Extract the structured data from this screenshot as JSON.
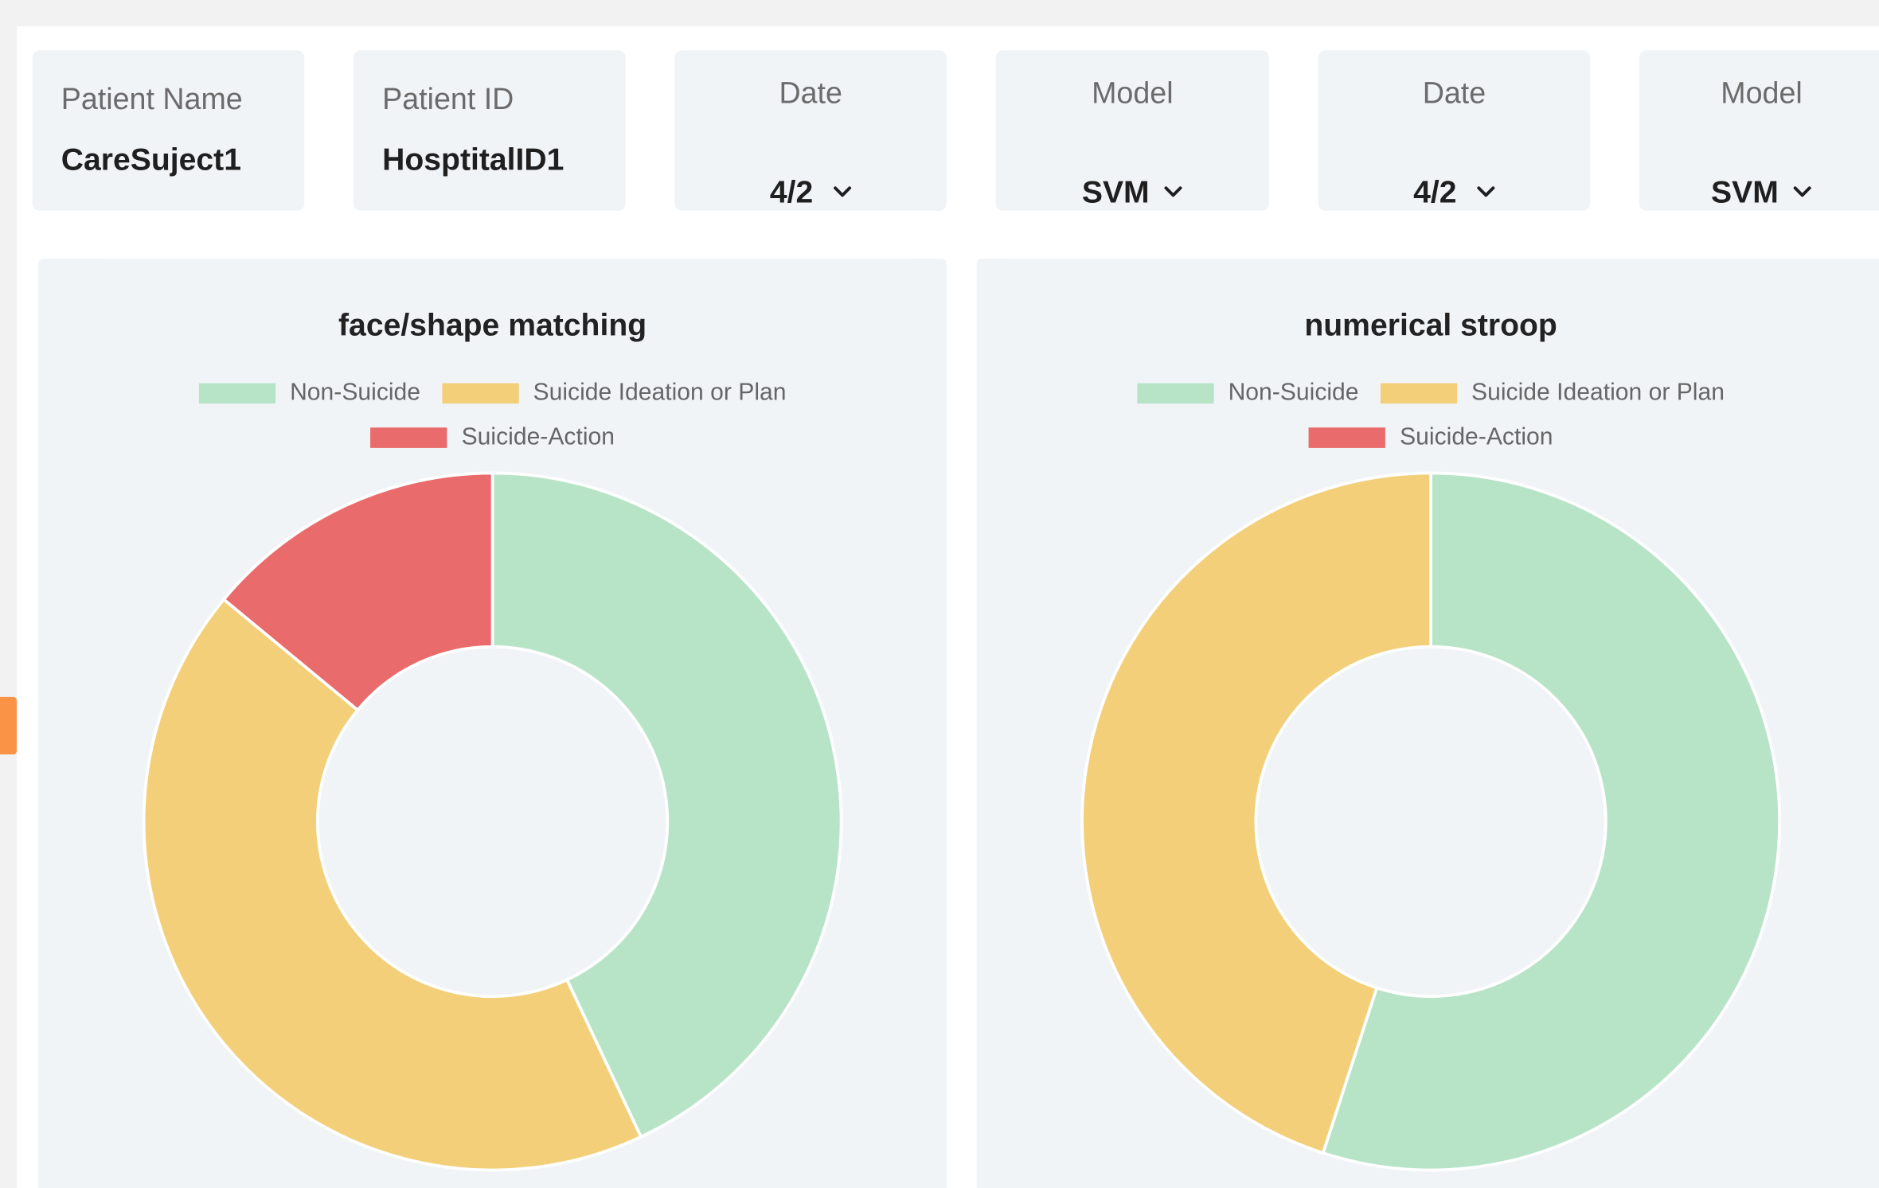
{
  "header": {
    "patient_name": {
      "label": "Patient Name",
      "value": "CareSuject1"
    },
    "patient_id": {
      "label": "Patient ID",
      "value": "HosptitalID1"
    },
    "selectors": [
      {
        "label": "Date",
        "value": "4/2"
      },
      {
        "label": "Model",
        "value": "SVM"
      },
      {
        "label": "Date",
        "value": "4/2"
      },
      {
        "label": "Model",
        "value": "SVM"
      }
    ]
  },
  "colors": {
    "non_suicide": "#b7e4c7",
    "ideation": "#f3cf7a",
    "action": "#ea6b6b",
    "accent_tab": "#fa9346"
  },
  "legend": {
    "non_suicide": "Non-Suicide",
    "ideation": "Suicide Ideation or Plan",
    "action": "Suicide-Action"
  },
  "chart_data": [
    {
      "type": "pie",
      "title": "face/shape matching",
      "categories": [
        "Non-Suicide",
        "Suicide Ideation or Plan",
        "Suicide-Action"
      ],
      "values": [
        43,
        43,
        14
      ],
      "legend_position": "top"
    },
    {
      "type": "pie",
      "title": "numerical stroop",
      "categories": [
        "Non-Suicide",
        "Suicide Ideation or Plan",
        "Suicide-Action"
      ],
      "values": [
        55,
        45,
        0
      ],
      "legend_position": "top"
    }
  ]
}
